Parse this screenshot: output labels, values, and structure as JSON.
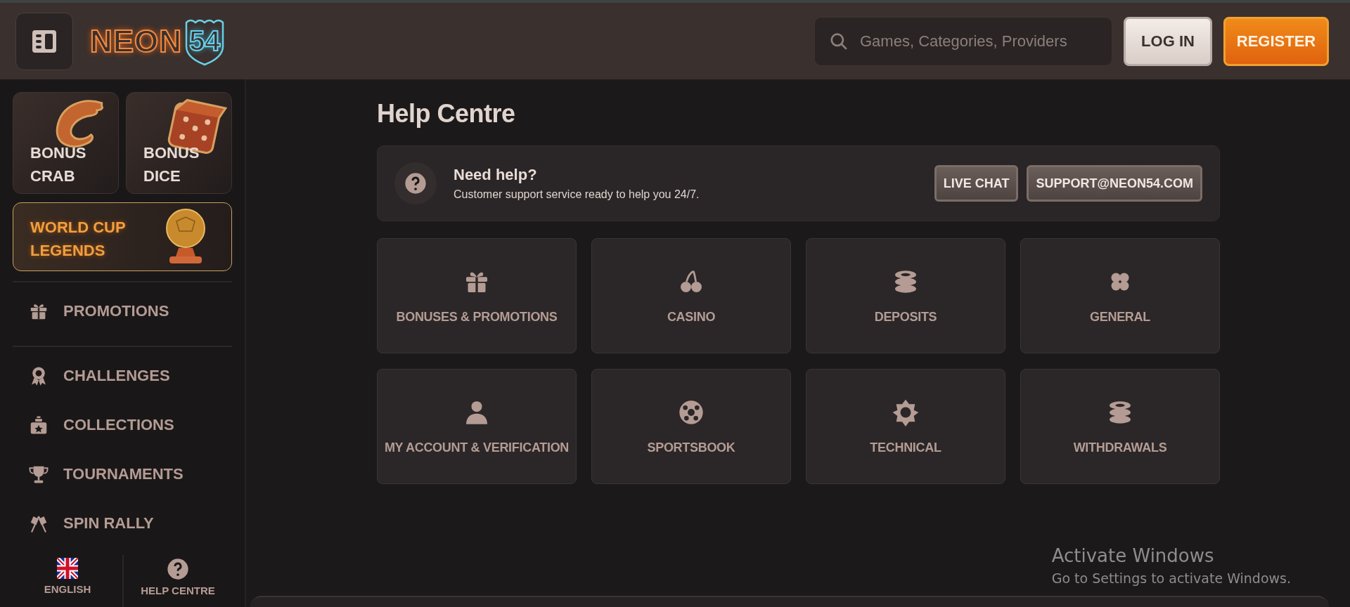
{
  "header": {
    "logo_text": "NEON",
    "logo_number": "54",
    "search": {
      "placeholder": "Games, Categories, Providers"
    },
    "buttons": [
      {
        "label": "LOG IN",
        "kind": "secondary"
      },
      {
        "label": "REGISTER",
        "kind": "primary"
      }
    ]
  },
  "sidebar": {
    "promo_cards": [
      {
        "title_lines": [
          "BONUS",
          "CRAB"
        ],
        "highlighted": false
      },
      {
        "title_lines": [
          "BONUS",
          "DICE"
        ],
        "highlighted": false
      },
      {
        "title_lines": [
          "WORLD CUP",
          "LEGENDS"
        ],
        "highlighted": true
      }
    ],
    "nav_groups": [
      [
        {
          "label": "PROMOTIONS"
        }
      ],
      [
        {
          "label": "CHALLENGES"
        },
        {
          "label": "COLLECTIONS"
        },
        {
          "label": "TOURNAMENTS"
        },
        {
          "label": "SPIN RALLY"
        }
      ]
    ],
    "footer": [
      {
        "label": "ENGLISH"
      },
      {
        "label": "HELP CENTRE"
      }
    ]
  },
  "main": {
    "title": "Help Centre",
    "help_banner": {
      "title": "Need help?",
      "text": "Customer support service ready to help you 24/7.",
      "buttons": [
        "LIVE CHAT",
        "SUPPORT@NEON54.COM"
      ]
    },
    "categories": [
      {
        "label": "BONUSES & PROMOTIONS"
      },
      {
        "label": "CASINO"
      },
      {
        "label": "DEPOSITS"
      },
      {
        "label": "GENERAL"
      },
      {
        "label": "MY ACCOUNT & VERIFICATION"
      },
      {
        "label": "SPORTSBOOK"
      },
      {
        "label": "TECHNICAL"
      },
      {
        "label": "WITHDRAWALS"
      }
    ]
  },
  "os_notice": {
    "title": "Activate Windows",
    "text": "Go to Settings to activate Windows."
  }
}
